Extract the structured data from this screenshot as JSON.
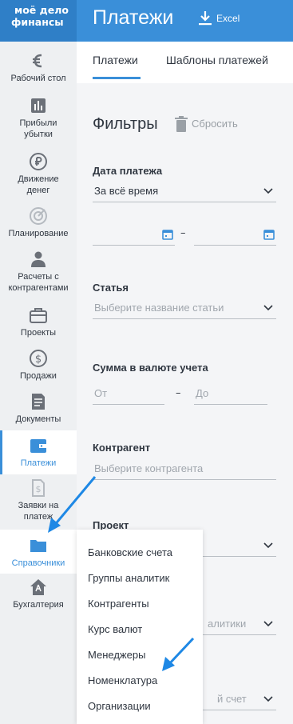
{
  "header": {
    "logo_line1": "моё дело",
    "logo_line2": "финансы",
    "title": "Платежи",
    "excel_label": "Excel",
    "bg_color": "#3a8fd9"
  },
  "sidebar": {
    "items": [
      {
        "label": "Рабочий стол",
        "icon": "wallet-euro-icon"
      },
      {
        "label": "Прибыли убытки",
        "icon": "bar-chart-icon"
      },
      {
        "label": "Движение денег",
        "icon": "ruble-exchange-icon"
      },
      {
        "label": "Планирование",
        "icon": "target-icon"
      },
      {
        "label": "Расчеты с контрагентами",
        "icon": "person-icon"
      },
      {
        "label": "Проекты",
        "icon": "briefcase-icon"
      },
      {
        "label": "Продажи",
        "icon": "dollar-icon"
      },
      {
        "label": "Документы",
        "icon": "document-icon"
      },
      {
        "label": "Платежи",
        "icon": "wallet-icon"
      },
      {
        "label": "Заявки на платеж",
        "icon": "request-dollar-icon"
      },
      {
        "label": "Справочники",
        "icon": "folder-icon"
      },
      {
        "label": "Бухгалтерия",
        "icon": "house-icon"
      }
    ]
  },
  "tabs": {
    "payments": "Платежи",
    "templates": "Шаблоны платежей"
  },
  "filters": {
    "title": "Фильтры",
    "reset": "Сбросить",
    "date_label": "Дата платежа",
    "date_value": "За всё время",
    "date_dash": "–",
    "article_label": "Статья",
    "article_placeholder": "Выберите название статьи",
    "sum_label": "Сумма в валюте учета",
    "sum_from": "От",
    "sum_to": "До",
    "sum_dash": "–",
    "contractor_label": "Контрагент",
    "contractor_placeholder": "Выберите контрагента",
    "project_label": "Проект",
    "analytics_partial": "алитики",
    "account_partial": "й счет"
  },
  "dropdown": {
    "items": [
      "Банковские счета",
      "Группы аналитик",
      "Контрагенты",
      "Курс валют",
      "Менеджеры",
      "Номенклатура",
      "Организации"
    ]
  },
  "colors": {
    "accent": "#3a8fd9",
    "sidebar_bg": "#eef0f2",
    "panel_bg": "#f4f5f7"
  }
}
